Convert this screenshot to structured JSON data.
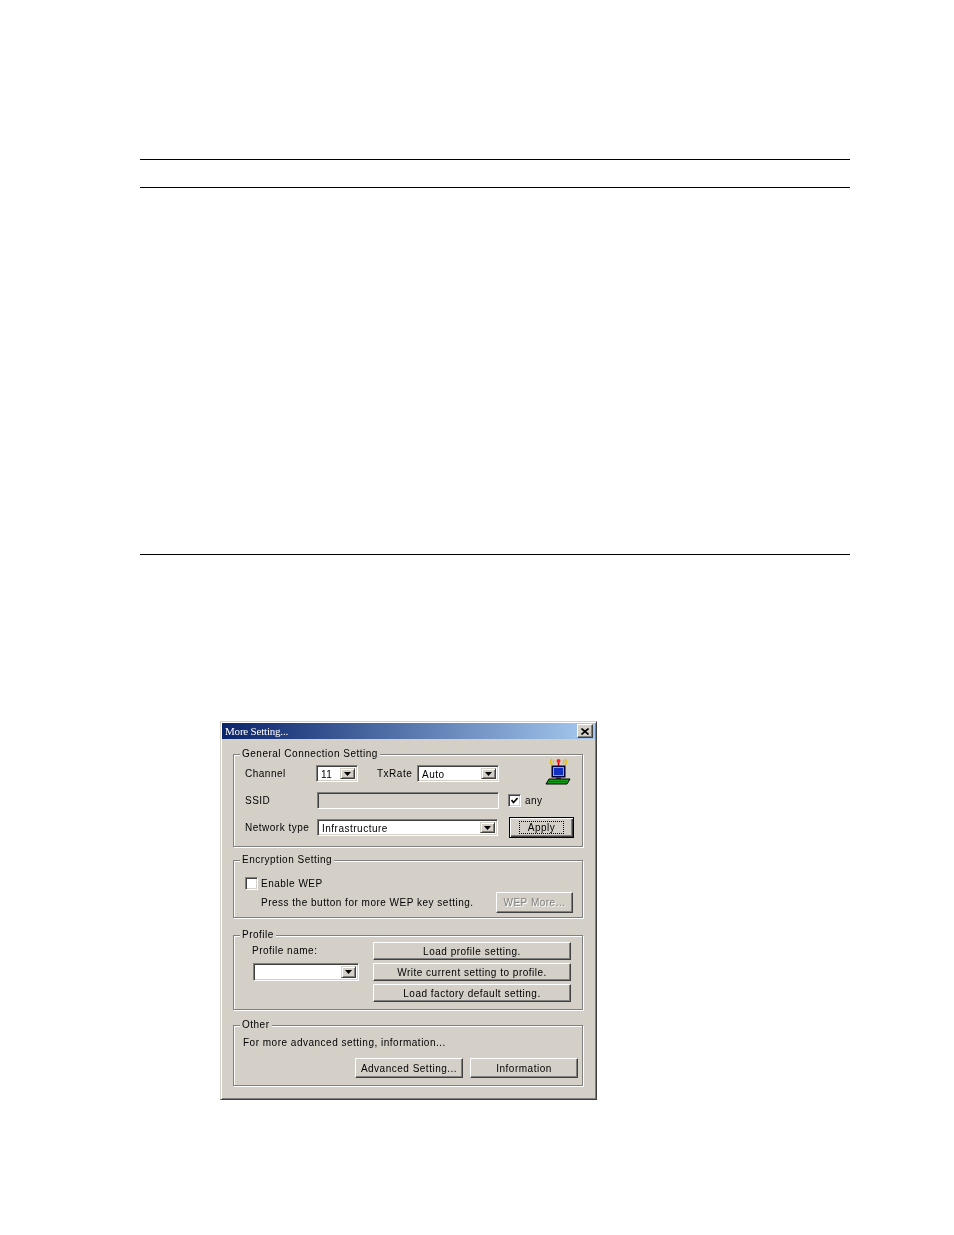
{
  "window": {
    "title": "More Setting..."
  },
  "general_connection": {
    "title": "General Connection Setting",
    "channel": {
      "label": "Channel",
      "value": "11"
    },
    "txrate": {
      "label": "TxRate",
      "value": "Auto"
    },
    "ssid": {
      "label": "SSID",
      "disabled": true
    },
    "any": {
      "label": "any",
      "checked": true
    },
    "network_type": {
      "label": "Network type",
      "value": "Infrastructure"
    },
    "apply_button": {
      "label": "Apply",
      "focused": true
    }
  },
  "encryption": {
    "title": "Encryption Setting",
    "enable_wep": {
      "label": "Enable WEP",
      "checked": false
    },
    "hint": "Press the button for more WEP key setting.",
    "wep_more_button": {
      "label": "WEP More...",
      "disabled": true
    }
  },
  "profile": {
    "title": "Profile",
    "name_label": "Profile name:",
    "buttons": [
      {
        "label": "Load profile setting."
      },
      {
        "label": "Write current setting to profile."
      },
      {
        "label": "Load factory default setting."
      }
    ]
  },
  "other": {
    "title": "Other",
    "text": "For more advanced setting, information...",
    "buttons": [
      {
        "label": "Advanced Setting..."
      },
      {
        "label": "Information"
      }
    ]
  }
}
